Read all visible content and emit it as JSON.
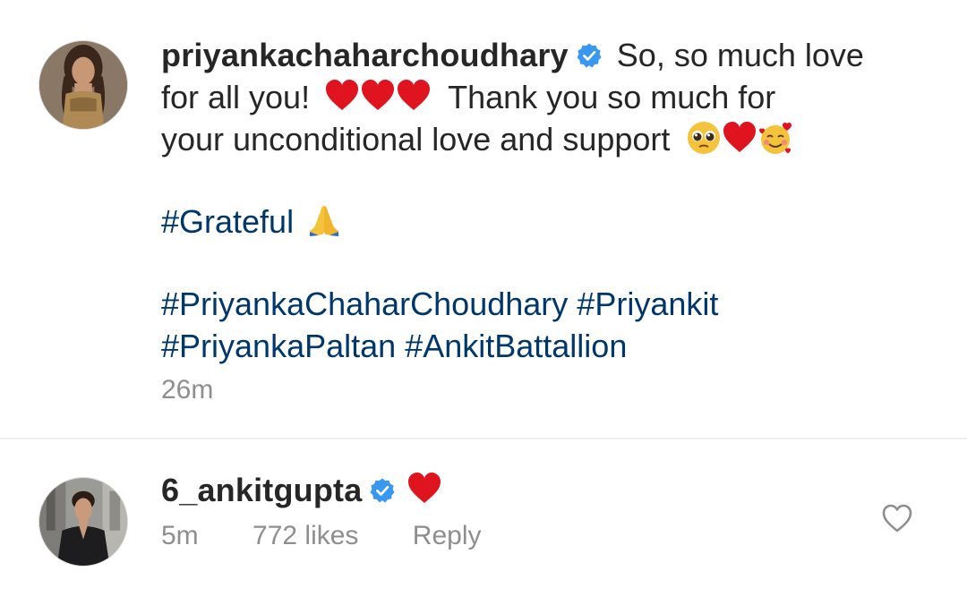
{
  "comment_main": {
    "username": "priyankachaharchoudhary",
    "verified_icon": "verified-badge-icon",
    "text_line1": "So, so much love",
    "text_line2_a": "for all you!",
    "text_line2_b": "Thank you so much for",
    "text_line3": "your unconditional love and support",
    "hashtag_grateful": "#Grateful",
    "hashtags_line1_a": "#PriyankaChaharChoudhary",
    "hashtags_line1_b": "#Priyankit",
    "hashtags_line2_a": "#PriyankaPaltan",
    "hashtags_line2_b": "#AnkitBattallion",
    "timestamp": "26m"
  },
  "reply_comment": {
    "username": "6_ankitgupta",
    "timestamp": "5m",
    "likes": "772 likes",
    "reply_label": "Reply"
  },
  "colors": {
    "hashtag": "#00376b",
    "meta": "#8e8e8e",
    "verified": "#3897f0",
    "heart": "#e0141e"
  }
}
